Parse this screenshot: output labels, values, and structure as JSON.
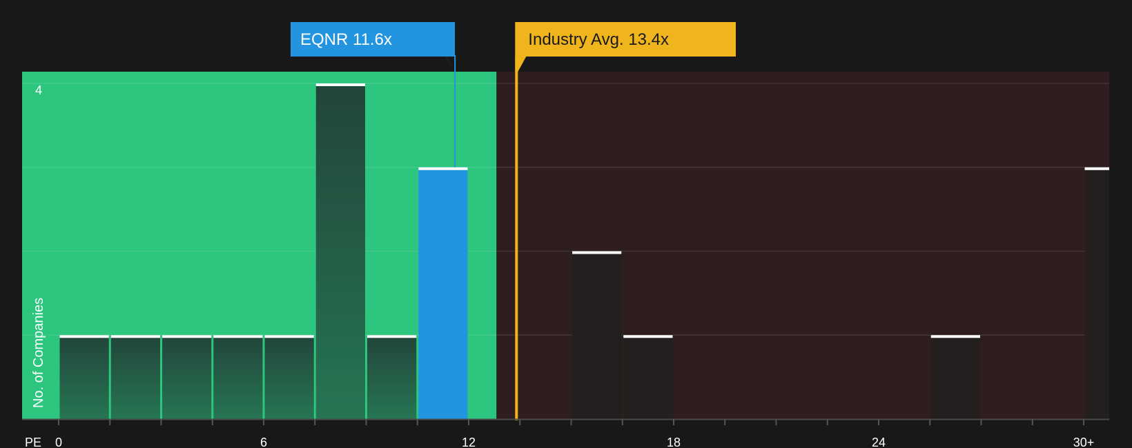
{
  "chart_data": {
    "type": "bar",
    "x_axis_label": "PE",
    "y_axis_label": "No. of Companies",
    "x_ticks": [
      "0",
      "6",
      "12",
      "18",
      "24",
      "30+"
    ],
    "y_tick_labels": [
      "4"
    ],
    "ylim": [
      0,
      4
    ],
    "xlim": [
      0,
      30
    ],
    "bin_width": 1.5,
    "bins": [
      {
        "x_start": 0.0,
        "value": 1
      },
      {
        "x_start": 1.5,
        "value": 1
      },
      {
        "x_start": 3.0,
        "value": 1
      },
      {
        "x_start": 4.5,
        "value": 1
      },
      {
        "x_start": 6.0,
        "value": 1
      },
      {
        "x_start": 7.5,
        "value": 4
      },
      {
        "x_start": 9.0,
        "value": 1
      },
      {
        "x_start": 10.5,
        "value": 3,
        "highlight": true
      },
      {
        "x_start": 15.0,
        "value": 2
      },
      {
        "x_start": 16.5,
        "value": 1
      },
      {
        "x_start": 25.5,
        "value": 1
      },
      {
        "x_start": 30.0,
        "value": 3
      }
    ],
    "subject": {
      "label": "EQNR 11.6x",
      "value": 11.6,
      "color": "#2394e0"
    },
    "industry": {
      "label": "Industry Avg. 13.4x",
      "value": 13.4,
      "color": "#f0b51d"
    },
    "regions": {
      "below_color": "#2dc67e",
      "above_color": "#2e1e1f"
    },
    "grid": true
  }
}
